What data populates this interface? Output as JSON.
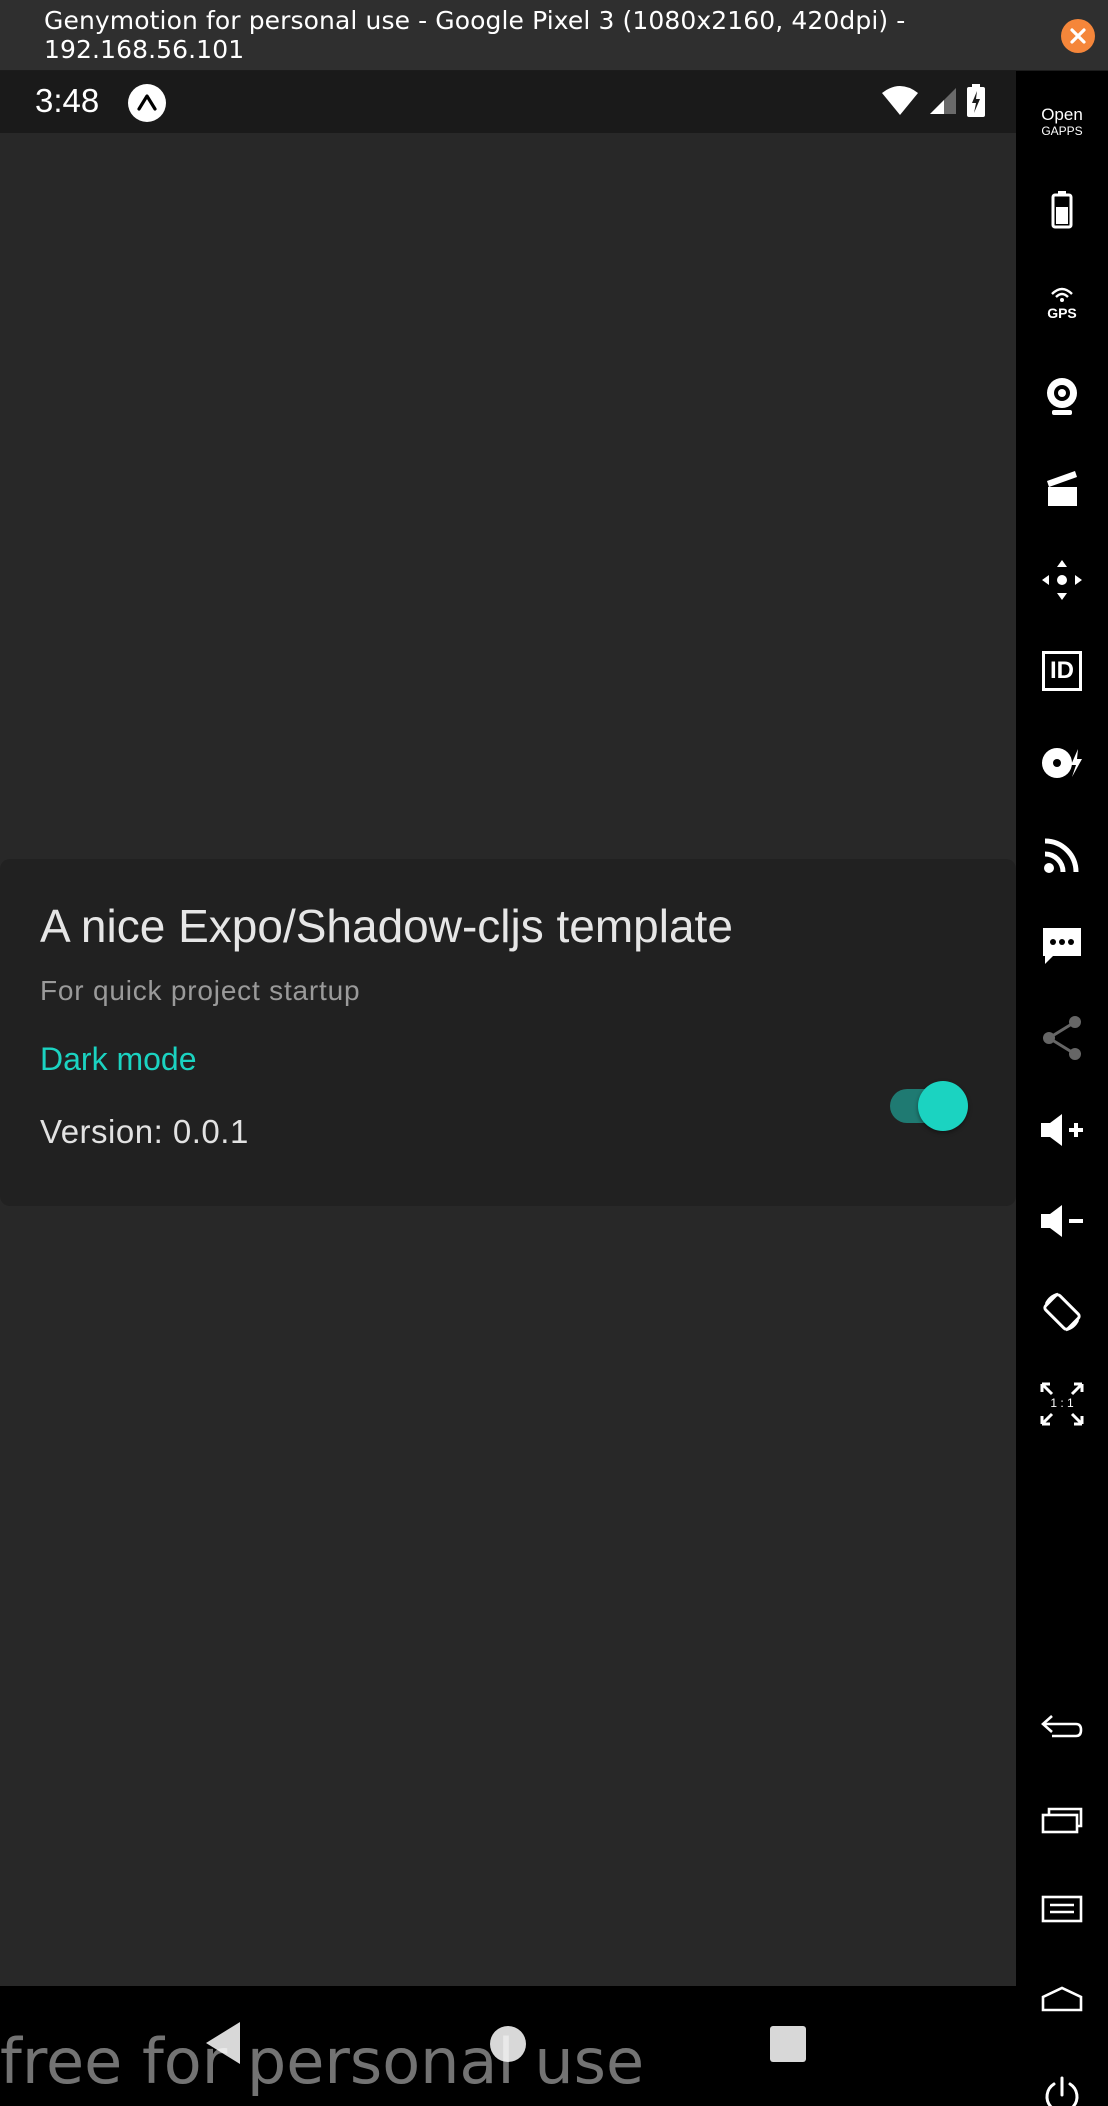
{
  "window": {
    "title": "Genymotion for personal use - Google Pixel 3 (1080x2160, 420dpi) - 192.168.56.101"
  },
  "statusbar": {
    "time": "3:48"
  },
  "app": {
    "title": "A nice Expo/Shadow-cljs template",
    "subtitle": "For quick project startup",
    "dark_mode_label": "Dark mode",
    "dark_mode_enabled": true,
    "version_text": "Version: 0.0.1",
    "accent_color": "#1bd3c1",
    "background_color": "#282828",
    "card_color": "#212121"
  },
  "toolbar": {
    "opengapps_line1": "Open",
    "opengapps_line2": "GAPPS",
    "gps_label": "GPS",
    "id_label": "ID",
    "pixel_perfect_label": "1 : 1",
    "items": [
      "opengapps-icon",
      "battery-icon",
      "gps-icon",
      "webcam-icon",
      "media-icon",
      "joystick-icon",
      "device-id-icon",
      "disk-io-icon",
      "network-icon",
      "sms-icon",
      "share-icon",
      "volume-up-icon",
      "volume-down-icon",
      "rotate-icon",
      "pixel-perfect-icon",
      "back-icon",
      "recent-apps-icon",
      "menu-icon",
      "home-icon",
      "power-icon"
    ]
  },
  "watermark": "free for personal use"
}
